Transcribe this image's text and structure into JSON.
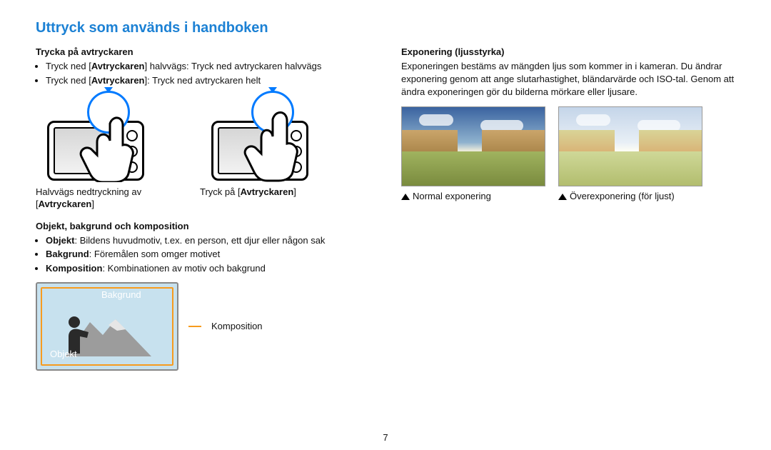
{
  "page_number": "7",
  "title": "Uttryck som används i handboken",
  "left": {
    "shutter": {
      "heading": "Trycka på avtryckaren",
      "b1_pre": "Tryck ned [",
      "b1_bold": "Avtryckaren",
      "b1_post": "] halvvägs: Tryck ned avtryckaren halvvägs",
      "b2_pre": "Tryck ned [",
      "b2_bold": "Avtryckaren",
      "b2_post": "]: Tryck ned avtryckaren helt",
      "cap1_line1": "Halvvägs nedtryckning av",
      "cap1_line2_open": "[",
      "cap1_line2_bold": "Avtryckaren",
      "cap1_line2_close": "]",
      "cap2_pre": "Tryck på [",
      "cap2_bold": "Avtryckaren",
      "cap2_post": "]"
    },
    "composition": {
      "heading": "Objekt, bakgrund och komposition",
      "b1_bold": "Objekt",
      "b1_rest": ": Bildens huvudmotiv, t.ex. en person, ett djur eller någon sak",
      "b2_bold": "Bakgrund",
      "b2_rest": ": Föremålen som omger motivet",
      "b3_bold": "Komposition",
      "b3_rest": ": Kombinationen av motiv och bakgrund",
      "label_bakgrund": "Bakgrund",
      "label_objekt": "Objekt",
      "label_komp": "Komposition"
    }
  },
  "right": {
    "heading": "Exponering (ljusstyrka)",
    "para": "Exponeringen bestäms av mängden ljus som kommer in i kameran. Du ändrar exponering genom att ange slutarhastighet, bländarvärde och ISO-tal. Genom att ändra exponeringen gör du bilderna mörkare eller ljusare.",
    "cap_normal": "Normal exponering",
    "cap_over": "Överexponering (för ljust)"
  }
}
